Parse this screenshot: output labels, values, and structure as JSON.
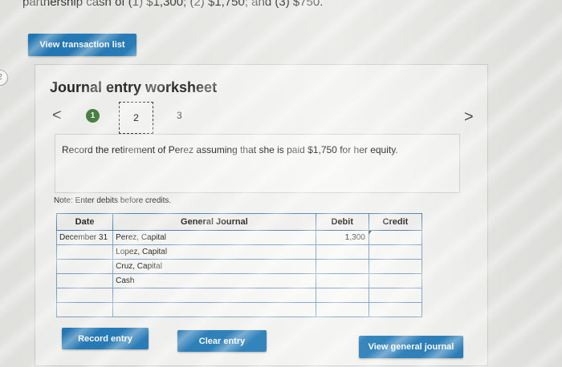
{
  "top_text": "partnership cash of (1) $1,300; (2) $1,750; and (3) $750.",
  "left_badge": "2",
  "buttons": {
    "view_transaction_list": "View transaction list",
    "record_entry": "Record entry",
    "clear_entry": "Clear entry",
    "view_general_journal": "View general journal"
  },
  "worksheet": {
    "title": "Journal entry worksheet",
    "prev_glyph": "<",
    "next_glyph": ">",
    "steps": [
      "1",
      "2",
      "3"
    ],
    "instruction": "Record the retirement of Perez assuming that she is paid $1,750 for her equity.",
    "note": "Note: Enter debits before credits."
  },
  "journal": {
    "headers": {
      "date": "Date",
      "account": "General Journal",
      "debit": "Debit",
      "credit": "Credit"
    },
    "rows": [
      {
        "date": "December 31",
        "account": "Perez, Capital",
        "debit": "1,300",
        "credit": ""
      },
      {
        "date": "",
        "account": "Lopez, Capital",
        "debit": "",
        "credit": ""
      },
      {
        "date": "",
        "account": "Cruz, Capital",
        "debit": "",
        "credit": ""
      },
      {
        "date": "",
        "account": "Cash",
        "debit": "",
        "credit": ""
      },
      {
        "date": "",
        "account": "",
        "debit": "",
        "credit": ""
      },
      {
        "date": "",
        "account": "",
        "debit": "",
        "credit": ""
      }
    ]
  },
  "colors": {
    "button": "#1f78b7",
    "step_active": "#43803c",
    "table_border": "#4d7fb0"
  }
}
